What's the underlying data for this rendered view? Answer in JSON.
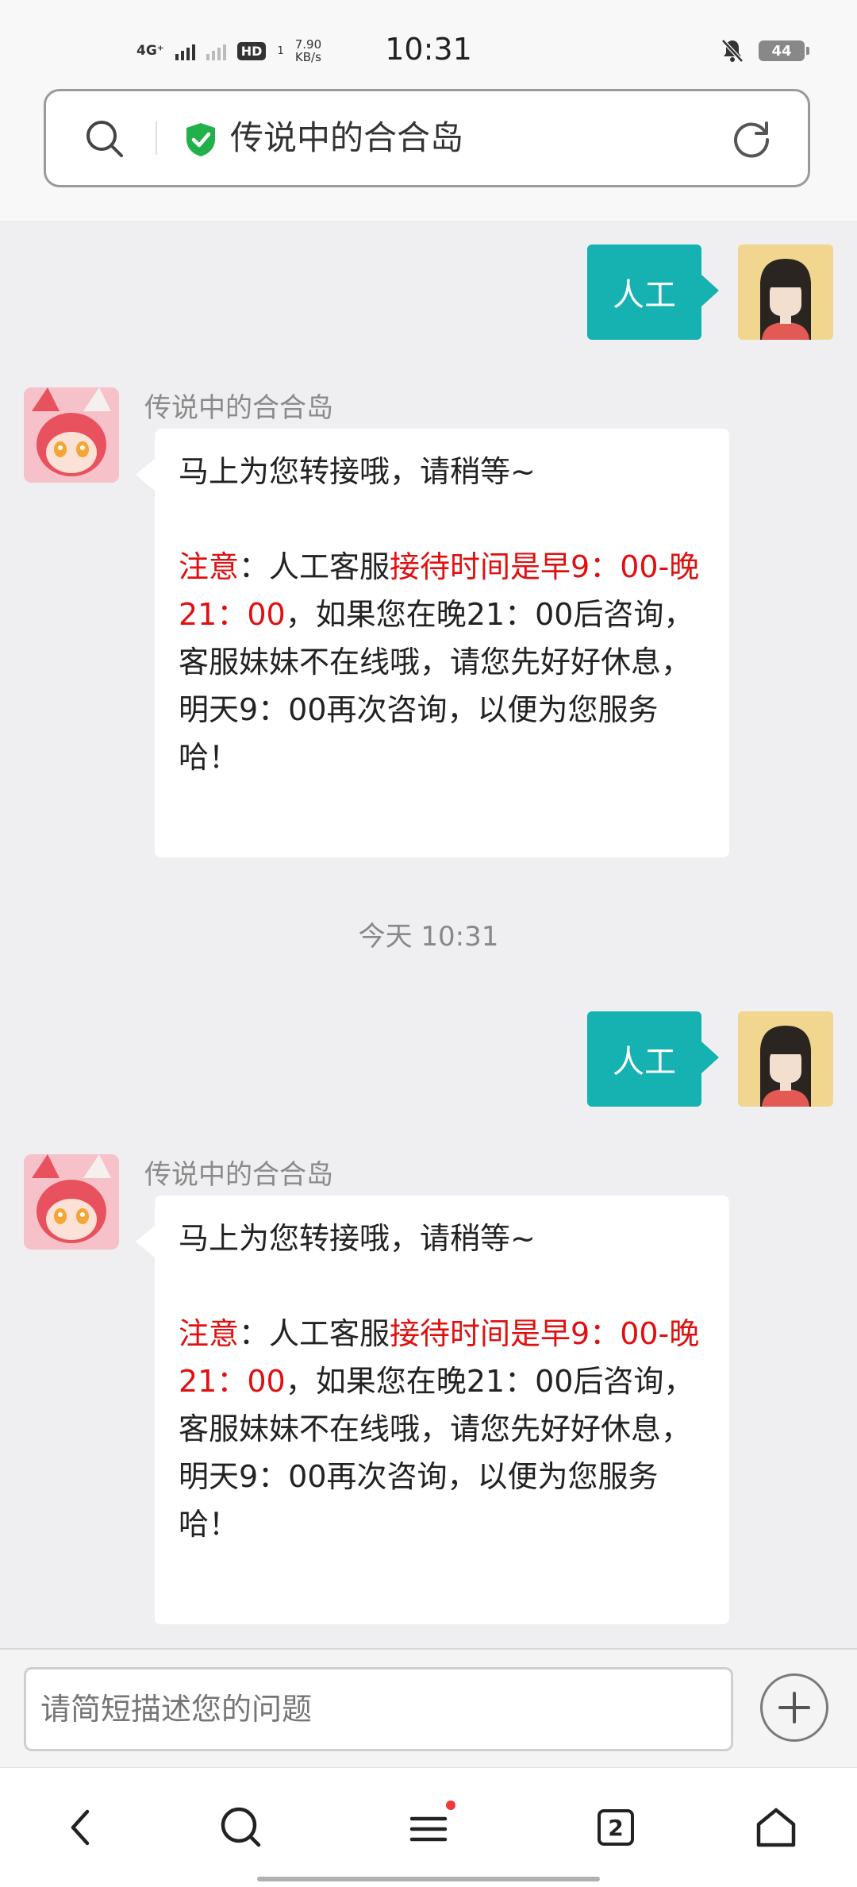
{
  "status_bar": {
    "network": "4G⁺",
    "hd": "HD",
    "hd_sub": "1",
    "speed_value": "7.90",
    "speed_unit": "KB/s",
    "time": "10:31",
    "battery": "44"
  },
  "address_bar": {
    "title": "传说中的合合岛"
  },
  "chat": {
    "messages": [
      {
        "text": "人工"
      },
      {
        "sender": "传说中的合合岛",
        "line1": "马上为您转接哦，请稍等~",
        "notice_label": "注意",
        "notice_colon": "：人工客服",
        "hours_red": "接待时间是早9：00-晚21：00",
        "rest": "，如果您在晚21：00后咨询，客服妹妹不在线哦，请您先好好休息，明天9：00再次咨询，以便为您服务哈！"
      },
      {
        "text": "今天 10:31"
      },
      {
        "text": "人工"
      },
      {
        "sender": "传说中的合合岛",
        "line1": "马上为您转接哦，请稍等~",
        "notice_label": "注意",
        "notice_colon": "：人工客服",
        "hours_red": "接待时间是早9：00-晚21：00",
        "rest": "，如果您在晚21：00后咨询，客服妹妹不在线哦，请您先好好休息，明天9：00再次咨询，以便为您服务哈！"
      }
    ]
  },
  "input": {
    "placeholder": "请简短描述您的问题"
  },
  "bottom_nav": {
    "tab_count": "2"
  },
  "colors": {
    "accent": "#16b1b1",
    "alert": "#e01010",
    "badge": "#f03a3a"
  }
}
